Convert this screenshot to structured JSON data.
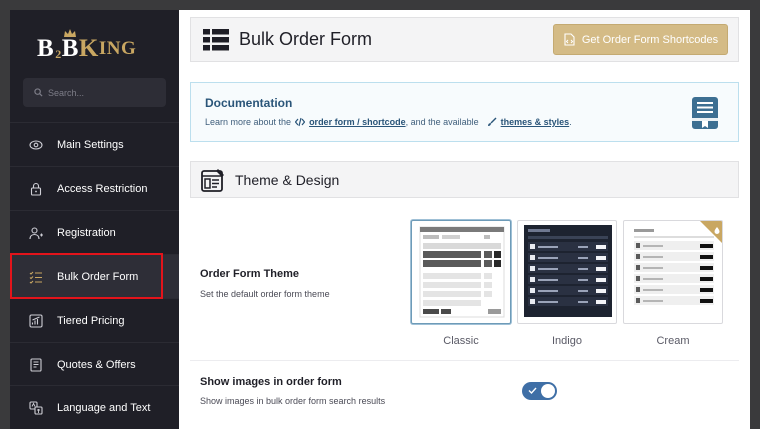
{
  "brand": {
    "logo_b1": "B",
    "logo_2": "2",
    "logo_b2": "B",
    "logo_k": "K",
    "logo_ing": "ING"
  },
  "search": {
    "placeholder": "Search..."
  },
  "sidebar": {
    "items": [
      {
        "label": "Main Settings",
        "icon": "eye-icon"
      },
      {
        "label": "Access Restriction",
        "icon": "lock-icon"
      },
      {
        "label": "Registration",
        "icon": "user-plus-icon"
      },
      {
        "label": "Bulk Order Form",
        "icon": "list-check-icon",
        "active": true
      },
      {
        "label": "Tiered Pricing",
        "icon": "chart-icon"
      },
      {
        "label": "Quotes & Offers",
        "icon": "quote-icon"
      },
      {
        "label": "Language and Text",
        "icon": "translate-icon"
      }
    ]
  },
  "header": {
    "title": "Bulk Order Form",
    "shortcode_button": "Get Order Form Shortcodes"
  },
  "documentation": {
    "title": "Documentation",
    "text_prefix": "Learn more about the",
    "link1": "order form / shortcode",
    "text_mid": ", and the available",
    "link2": "themes & styles",
    "text_suffix": "."
  },
  "section": {
    "title": "Theme & Design"
  },
  "theme_setting": {
    "title": "Order Form Theme",
    "description": "Set the default order form theme",
    "themes": [
      {
        "label": "Classic",
        "selected": true
      },
      {
        "label": "Indigo",
        "selected": false
      },
      {
        "label": "Cream",
        "selected": false,
        "premium": true
      }
    ]
  },
  "images_setting": {
    "title": "Show images in order form",
    "description": "Show images in bulk order form search results",
    "enabled": true
  },
  "colors": {
    "sidebar_bg": "#1f1f27",
    "accent_gold": "#c9a762",
    "toggle_blue": "#3f6fa6",
    "highlight_red": "#e3141b"
  }
}
